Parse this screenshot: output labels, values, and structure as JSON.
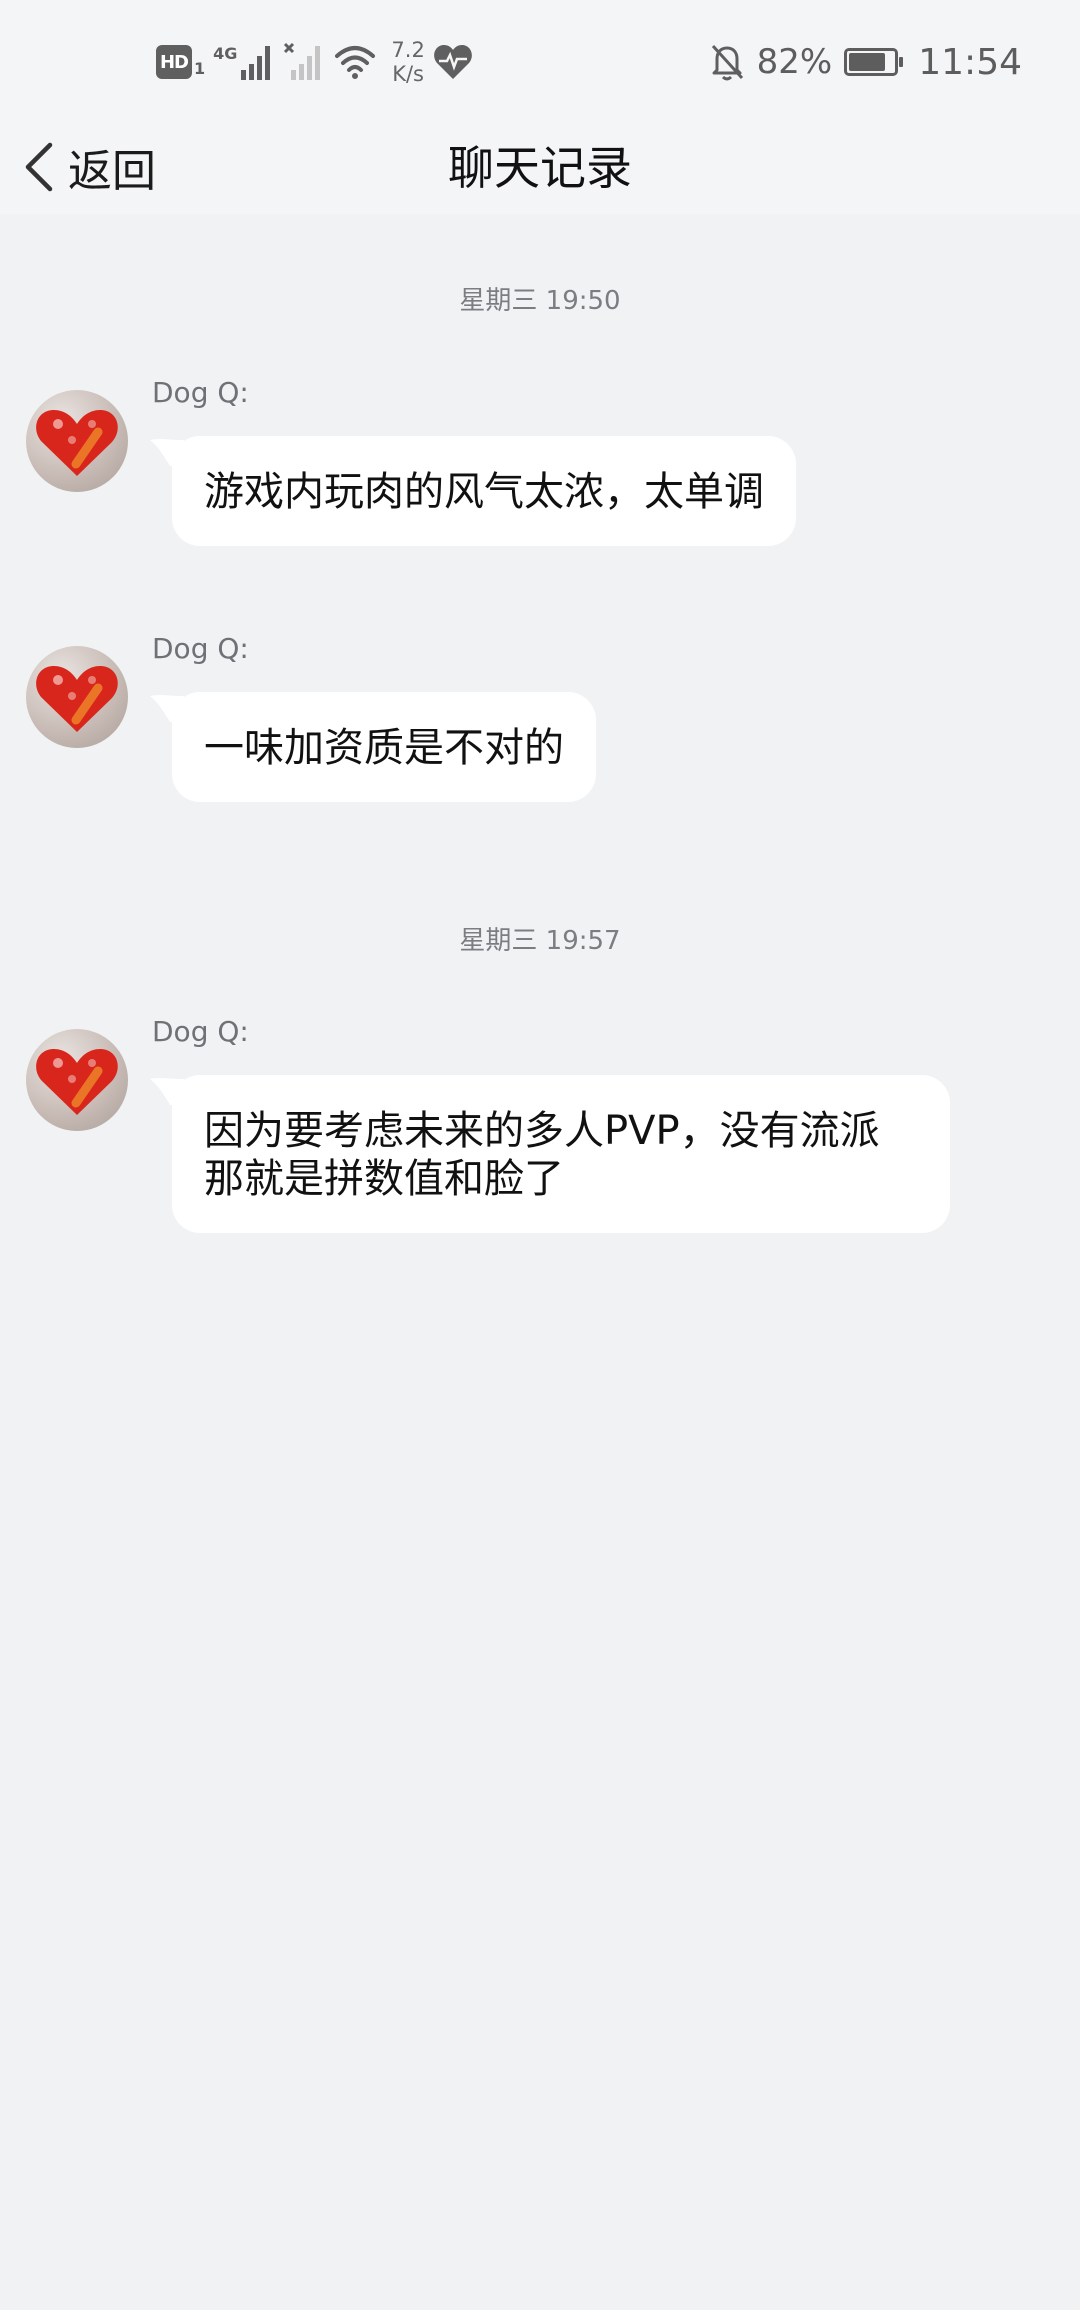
{
  "status_bar": {
    "hd_label": "HD",
    "hd_sub": "1",
    "network_type": "4G",
    "speed_value": "7.2",
    "speed_unit": "K/s",
    "battery_percent": 82,
    "battery_text": "82%",
    "time": "11:54",
    "icons": [
      "hd-icon",
      "cellular-signal-icon",
      "no-signal-icon",
      "wifi-icon",
      "health-heart-icon",
      "notifications-muted-icon",
      "battery-icon"
    ]
  },
  "nav": {
    "back_label": "返回",
    "title": "聊天记录"
  },
  "chat": {
    "timestamps": [
      "星期三 19:50",
      "星期三 19:57"
    ],
    "messages": [
      {
        "sender": "Dog Q:",
        "text": "游戏内玩肉的风气太浓，太单调"
      },
      {
        "sender": "Dog Q:",
        "text": "一味加资质是不对的"
      },
      {
        "sender": "Dog Q:",
        "text": "因为要考虑未来的多人PVP，没有流派那就是拼数值和脸了"
      }
    ]
  },
  "colors": {
    "background": "#f1f2f4",
    "bubble": "#ffffff",
    "secondary_text": "#6f7176",
    "avatar_heart": "#d8261c"
  }
}
